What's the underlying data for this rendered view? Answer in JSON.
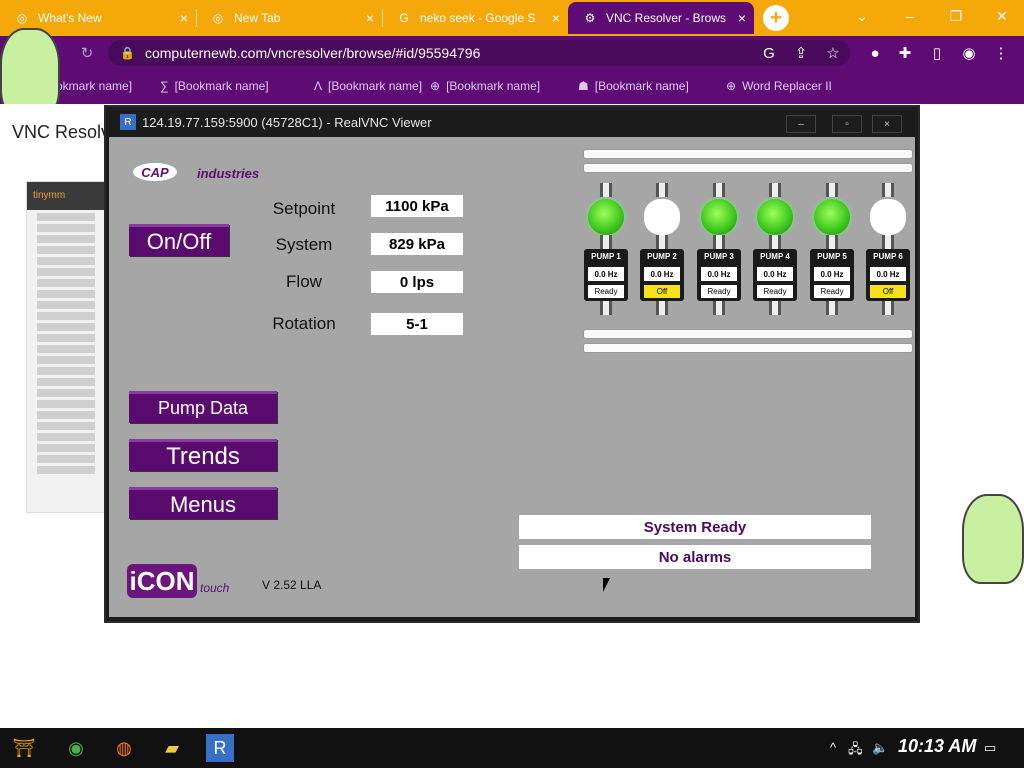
{
  "browser": {
    "tabs": [
      {
        "title": "What's New",
        "icon": "chrome-icon"
      },
      {
        "title": "New Tab",
        "icon": "chrome-icon"
      },
      {
        "title": "neko seek - Google S",
        "icon": "google-icon"
      },
      {
        "title": "VNC Resolver - Brows",
        "icon": "vnc-icon",
        "active": true
      }
    ],
    "url": "computernewb.com/vncresolver/browse/#id/95594796",
    "bookmarks": [
      "[Bookmark name]",
      "[Bookmark name]",
      "[Bookmark name]",
      "[Bookmark name]",
      "[Bookmark name]",
      "Word Replacer II"
    ],
    "accent": "#5e0c74",
    "tabstrip_color": "#f5a80a"
  },
  "page": {
    "title": "VNC Resolve"
  },
  "vnc_window": {
    "title": "124.19.77.159:5900 (45728C1) - RealVNC Viewer",
    "controls": [
      "–",
      "▫",
      "×"
    ]
  },
  "hmi": {
    "brand": {
      "logo": "CAP",
      "name": "industries"
    },
    "on_off_label": "On/Off",
    "readouts": [
      {
        "label": "Setpoint",
        "value": "1100 kPa"
      },
      {
        "label": "System",
        "value": "829 kPa"
      },
      {
        "label": "Flow",
        "value": "0 lps"
      },
      {
        "label": "Rotation",
        "value": "5-1"
      }
    ],
    "nav_buttons": [
      "Pump Data",
      "Trends",
      "Menus"
    ],
    "pumps": [
      {
        "name": "PUMP 1",
        "hz": "0.0 Hz",
        "status": "Ready",
        "light": "on"
      },
      {
        "name": "PUMP 2",
        "hz": "0.0 Hz",
        "status": "Off",
        "light": "off"
      },
      {
        "name": "PUMP 3",
        "hz": "0.0 Hz",
        "status": "Ready",
        "light": "on"
      },
      {
        "name": "PUMP 4",
        "hz": "0.0 Hz",
        "status": "Ready",
        "light": "on"
      },
      {
        "name": "PUMP 5",
        "hz": "0.0 Hz",
        "status": "Ready",
        "light": "on"
      },
      {
        "name": "PUMP 6",
        "hz": "0.0 Hz",
        "status": "Off",
        "light": "off"
      }
    ],
    "system_status": "System Ready",
    "alarm_status": "No alarms",
    "footer": {
      "logo": "iCON",
      "touch": "touch",
      "version": "V 2.52 LLA"
    }
  },
  "taskbar": {
    "clock": "10:13 AM"
  }
}
